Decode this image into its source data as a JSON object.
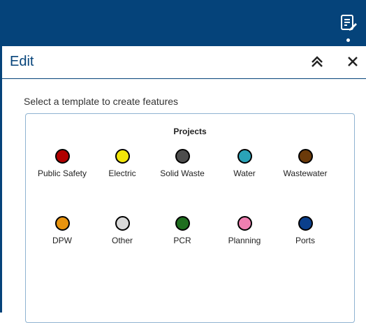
{
  "panel": {
    "title": "Edit",
    "instruction": "Select a template to create features"
  },
  "group": {
    "title": "Projects"
  },
  "templates": [
    {
      "label": "Public Safety",
      "color": "#b00000"
    },
    {
      "label": "Electric",
      "color": "#f2e60a"
    },
    {
      "label": "Solid Waste",
      "color": "#4d4d4d"
    },
    {
      "label": "Water",
      "color": "#2aa3b8"
    },
    {
      "label": "Wastewater",
      "color": "#6b3a0a"
    },
    {
      "label": "DPW",
      "color": "#e8940f"
    },
    {
      "label": "Other",
      "color": "#d9d9d9"
    },
    {
      "label": "PCR",
      "color": "#1f6e1f"
    },
    {
      "label": "Planning",
      "color": "#f07fb1"
    },
    {
      "label": "Ports",
      "color": "#0a3f8c"
    }
  ],
  "icons": {
    "toolbar": "edit-list-icon",
    "collapse": "chevrons-up-icon",
    "close": "close-icon"
  }
}
